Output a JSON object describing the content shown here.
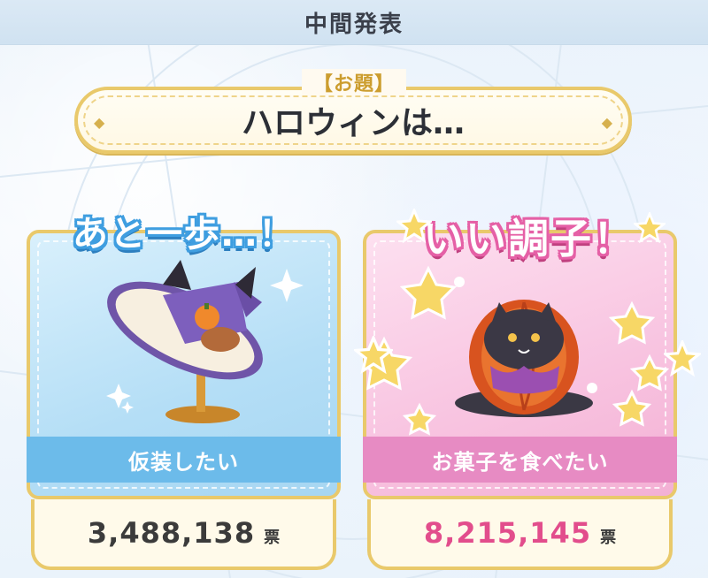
{
  "header": {
    "title": "中間発表"
  },
  "theme": {
    "label": "【お題】",
    "text": "ハロウィンは…"
  },
  "options": [
    {
      "badge": "あと一歩…！",
      "name": "仮装したい",
      "votes": "3,488,138",
      "unit": "票",
      "accent": "#6cbbea"
    },
    {
      "badge": "いい調子！",
      "name": "お菓子を食べたい",
      "votes": "8,215,145",
      "unit": "票",
      "accent": "#e78bc3"
    }
  ],
  "colors": {
    "gold_border": "#e9c96b",
    "pink_votes": "#e24d8c",
    "dark_votes": "#3b3b3b"
  },
  "icons": [
    "witch-hat-icon",
    "pumpkin-cat-pastry-icon",
    "star-icon",
    "sparkle-icon"
  ]
}
